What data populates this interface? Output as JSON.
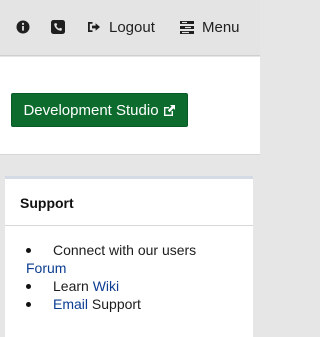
{
  "topbar": {
    "info_icon": "info-circle-icon",
    "phone_icon": "phone-square-icon",
    "logout_label": "Logout",
    "menu_label": "Menu"
  },
  "studio": {
    "button_label": "Development Studio",
    "icon": "external-link-icon"
  },
  "support": {
    "title": "Support",
    "items": [
      {
        "text": "Connect with our users",
        "link": "Forum"
      },
      {
        "text": "Learn ",
        "link": "Wiki"
      },
      {
        "link": "Email",
        "text": " Support"
      }
    ]
  },
  "colors": {
    "button_bg": "#0c6b2d",
    "link": "#0b3d91",
    "page_bg": "#e6e6e6"
  }
}
